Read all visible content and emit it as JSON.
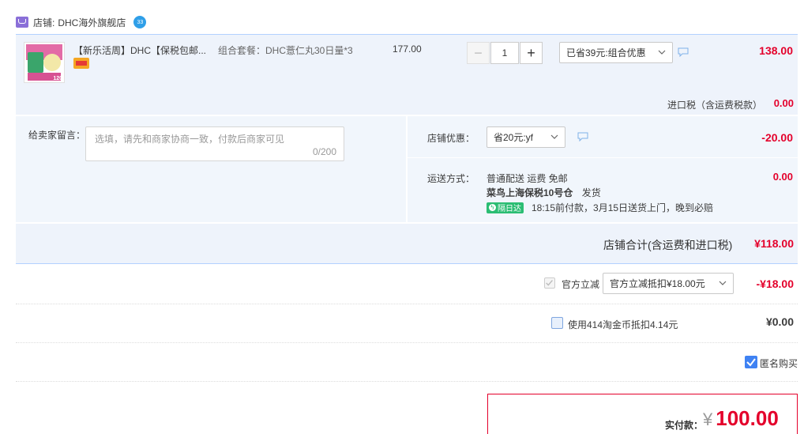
{
  "shop": {
    "label": "店铺:",
    "name": "DHC海外旗舰店",
    "badge": "33"
  },
  "item": {
    "title": "【新乐活周】DHC【保税包邮...",
    "combo": "组合套餐：DHC薏仁丸30日量*3",
    "unit_price": "177.00",
    "quantity": "1",
    "discount_select": "已省39元:组合优惠",
    "subtotal": "138.00",
    "image_badge": "120"
  },
  "tax": {
    "label": "进口税（含运费税款）",
    "value": "0.00"
  },
  "message": {
    "label": "给卖家留言：",
    "placeholder": "选填，请先和商家协商一致，付款后商家可见",
    "counter": "0/200"
  },
  "shop_discount": {
    "label": "店铺优惠：",
    "select": "省20元:yf",
    "value": "-20.00"
  },
  "shipping": {
    "label": "运送方式：",
    "method": "普通配送 运费 免邮",
    "warehouse": "菜鸟上海保税10号仓",
    "ship_text": "发货",
    "tag": "隔日达",
    "promise": "18:15前付款，3月15日送货上门，晚到必赔",
    "value": "0.00"
  },
  "store_total": {
    "label": "店铺合计(含运费和进口税)",
    "value": "¥118.00"
  },
  "official": {
    "label": "官方立减",
    "select": "官方立减抵扣¥18.00元",
    "value": "-¥18.00"
  },
  "coins": {
    "label": "使用414淘金币抵扣4.14元",
    "value": "¥0.00"
  },
  "anonymous": {
    "label": "匿名购买"
  },
  "payment": {
    "label": "实付款：",
    "currency": "¥",
    "value": "100.00"
  },
  "colors": {
    "accent_red": "#e4002b",
    "light_blue": "#eef3fb",
    "checkbox_blue": "#3f82f3",
    "tag_green": "#2bbd73"
  }
}
